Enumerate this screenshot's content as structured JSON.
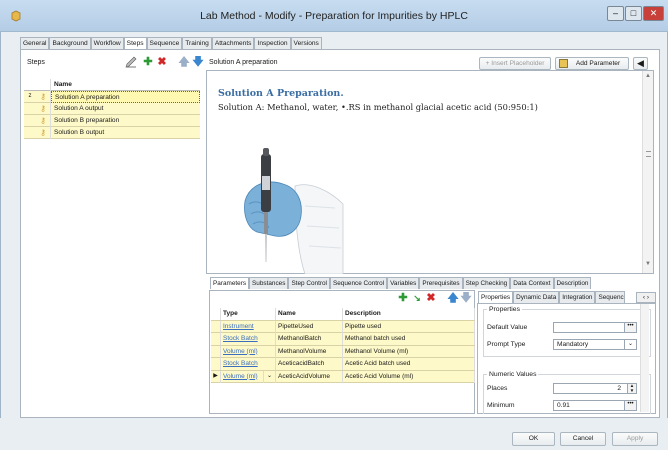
{
  "window": {
    "title": "Lab Method - Modify - Preparation for Impurities by HPLC",
    "minimize": "–",
    "maximize": "□",
    "close": "✕"
  },
  "tabs": [
    "General",
    "Background",
    "Workflow",
    "Steps",
    "Sequence",
    "Training",
    "Attachments",
    "Inspection",
    "Versions"
  ],
  "active_tab": "Steps",
  "steps": {
    "label": "Steps",
    "column_header": "Name",
    "rows": [
      {
        "marker": "ᴢ",
        "name": "Solution A preparation",
        "selected": true
      },
      {
        "marker": "",
        "name": "Solution A output",
        "selected": false
      },
      {
        "marker": "",
        "name": "Solution B preparation",
        "selected": false
      },
      {
        "marker": "",
        "name": "Solution B output",
        "selected": false
      }
    ]
  },
  "step_header": {
    "name": "Solution A preparation",
    "insert_placeholder": "+ Insert Placeholder",
    "add_parameter": "Add Parameter"
  },
  "document": {
    "heading": "Solution A Preparation.",
    "body": "Solution A: Methanol, water, •.RS in methanol glacial acetic acid (50:950:1)"
  },
  "bottom_tabs": [
    "Parameters",
    "Substances",
    "Step Control",
    "Sequence Control",
    "Variables",
    "Prerequisites",
    "Step Checking",
    "Data Context",
    "Description"
  ],
  "parameters": {
    "headers": [
      "Type",
      "Name",
      "Description"
    ],
    "rows": [
      {
        "type": "Instrument",
        "name": "PipetteUsed",
        "desc": "Pipette used",
        "current": false
      },
      {
        "type": "Stock Batch",
        "name": "MethanolBatch",
        "desc": "Methanol batch used",
        "current": false
      },
      {
        "type": "Volume (ml)",
        "name": "MethanolVolume",
        "desc": "Methanol Volume (ml)",
        "current": false
      },
      {
        "type": "Stock Batch",
        "name": "AceticacidBatch",
        "desc": "Acetic Acid batch used",
        "current": false
      },
      {
        "type": "Volume (ml)",
        "name": "AceticAcidVolume",
        "desc": "Acetic Acid Volume (ml)",
        "current": true
      }
    ]
  },
  "prop_tabs": [
    "Properties",
    "Dynamic Data",
    "Integration",
    "Sequence"
  ],
  "properties": {
    "section1": "Properties",
    "default_value_label": "Default Value",
    "default_value": "",
    "prompt_type_label": "Prompt Type",
    "prompt_type": "Mandatory",
    "section2": "Numeric Values",
    "places_label": "Places",
    "places": "2",
    "minimum_label": "Minimum",
    "minimum": "0.91"
  },
  "footer": {
    "ok": "OK",
    "cancel": "Cancel",
    "apply": "Apply"
  },
  "colors": {
    "accent": "#3a6da3",
    "row_highlight": "#fdf9c8",
    "link": "#3a6fc0"
  }
}
